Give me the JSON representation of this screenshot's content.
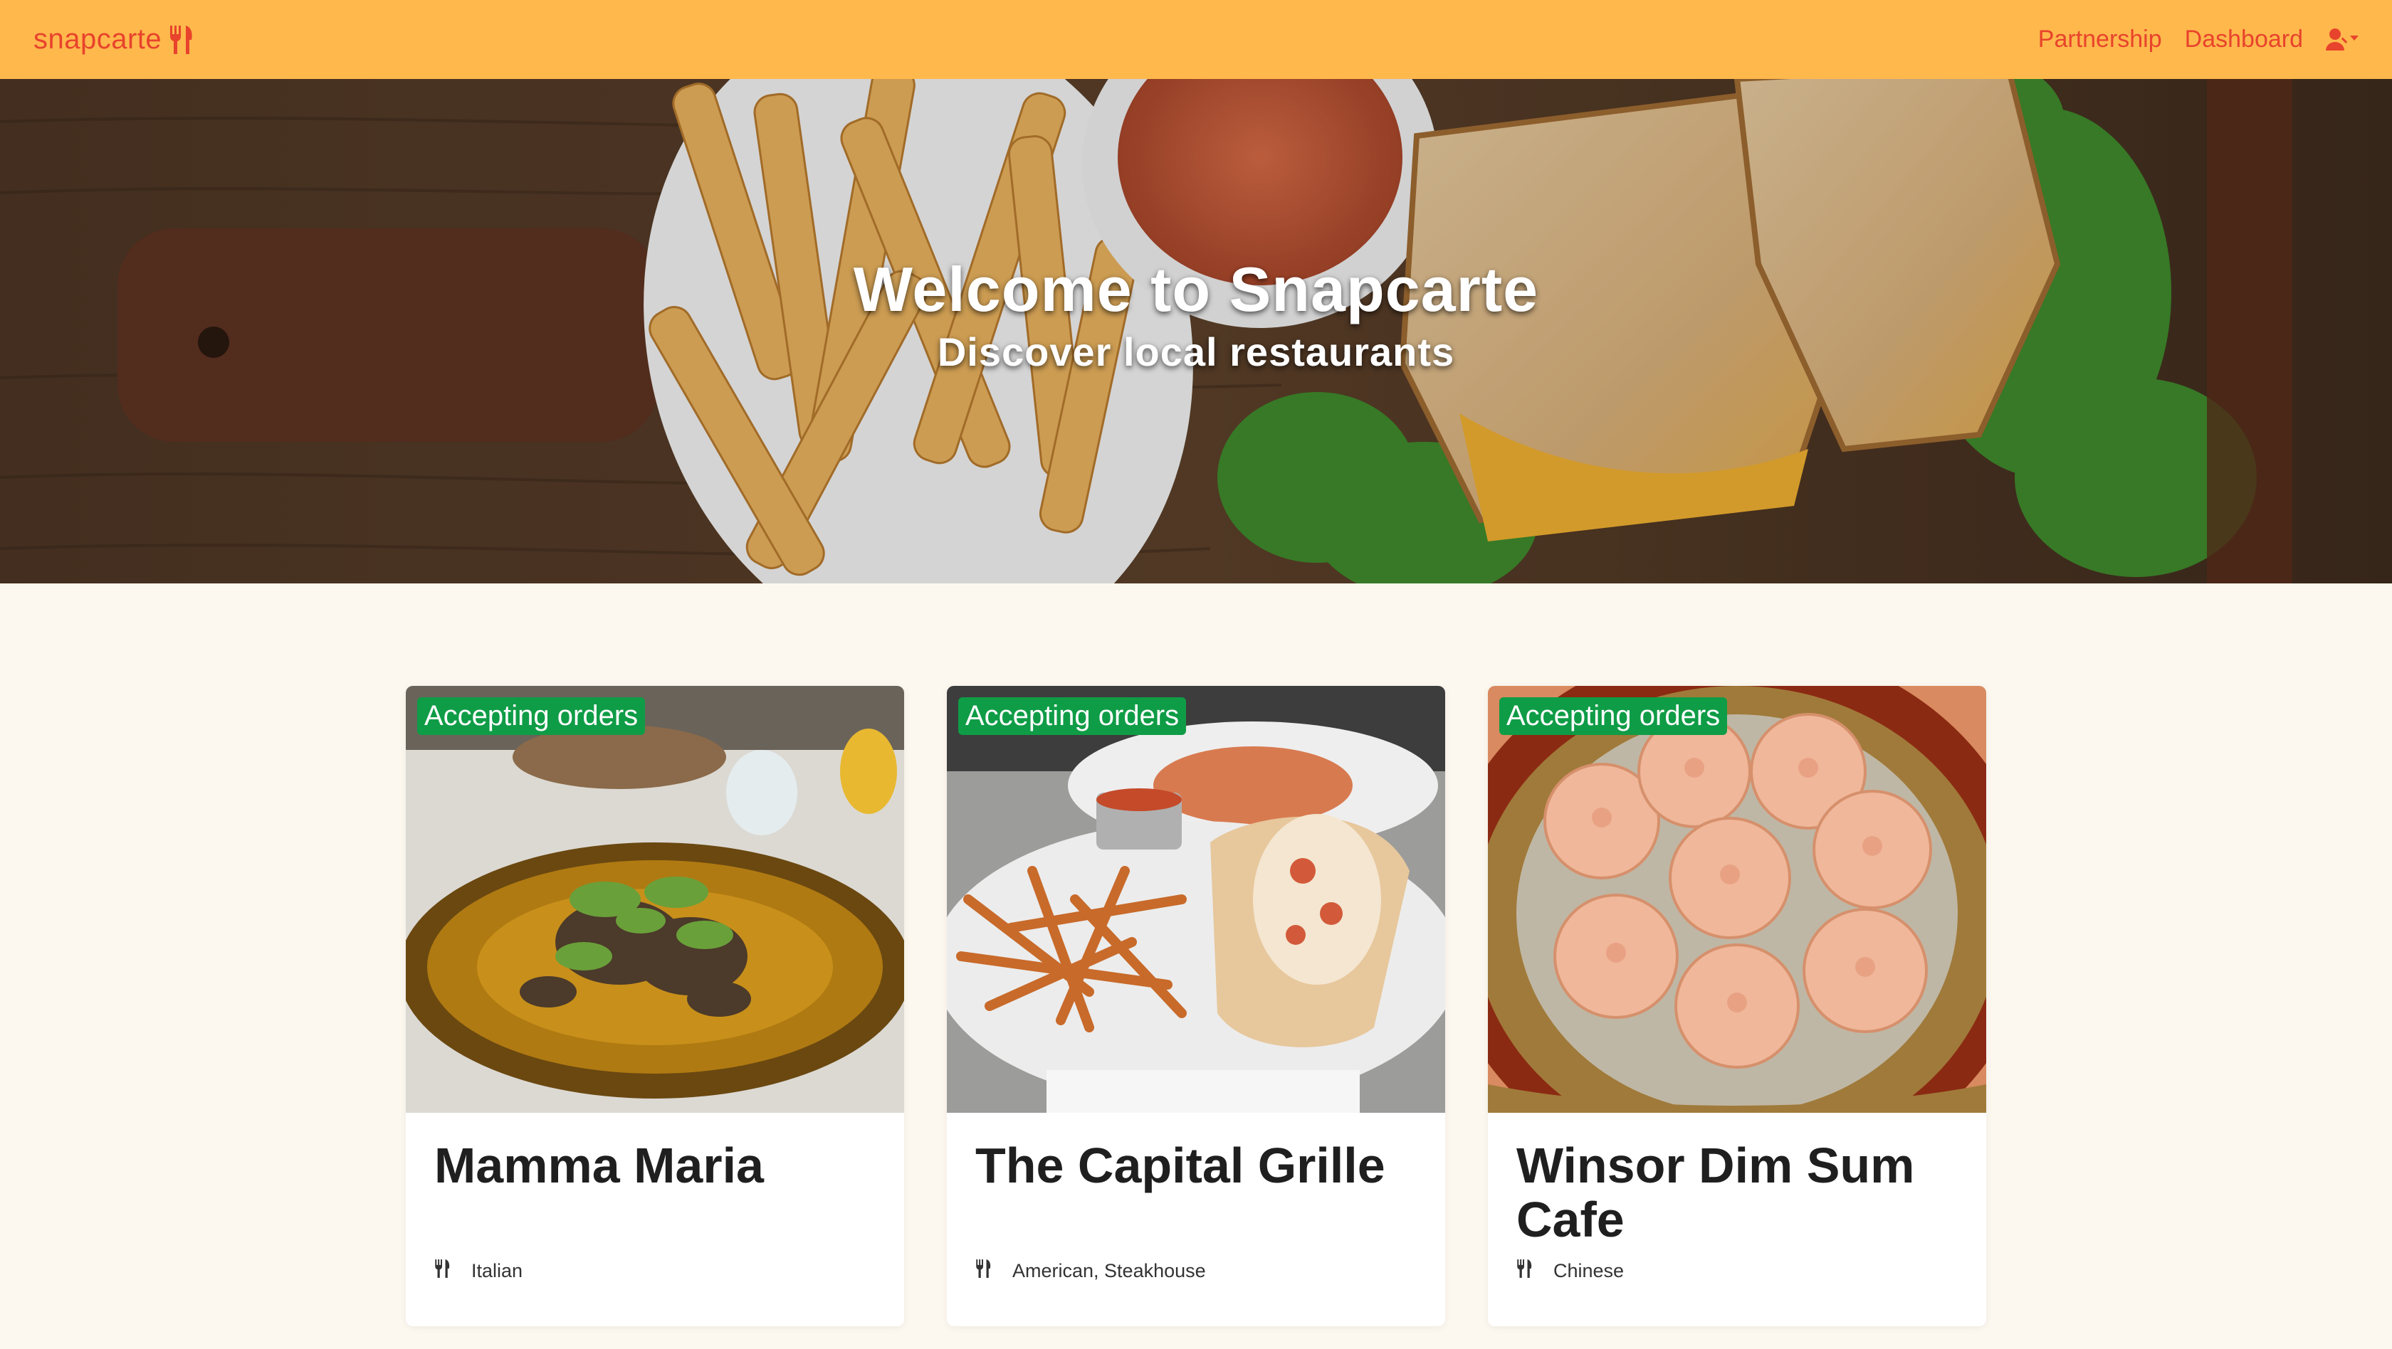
{
  "navbar": {
    "brand": "snapcarte",
    "brand_icon": "utensils-icon",
    "links": [
      {
        "label": "Partnership"
      },
      {
        "label": "Dashboard"
      }
    ],
    "user_icon": "user-dropdown-icon",
    "accent": "#e8432c",
    "background": "#ffb84c"
  },
  "hero": {
    "title": "Welcome to Snapcarte",
    "subtitle": "Discover local restaurants"
  },
  "restaurants": [
    {
      "name": "Mamma Maria",
      "status": "Accepting orders",
      "cuisine": "Italian"
    },
    {
      "name": "The Capital Grille",
      "status": "Accepting orders",
      "cuisine": "American, Steakhouse"
    },
    {
      "name": "Winsor Dim Sum Cafe",
      "status": "Accepting orders",
      "cuisine": "Chinese"
    }
  ],
  "colors": {
    "badge": "#0f9c46",
    "page_background": "#fcf8ef"
  }
}
